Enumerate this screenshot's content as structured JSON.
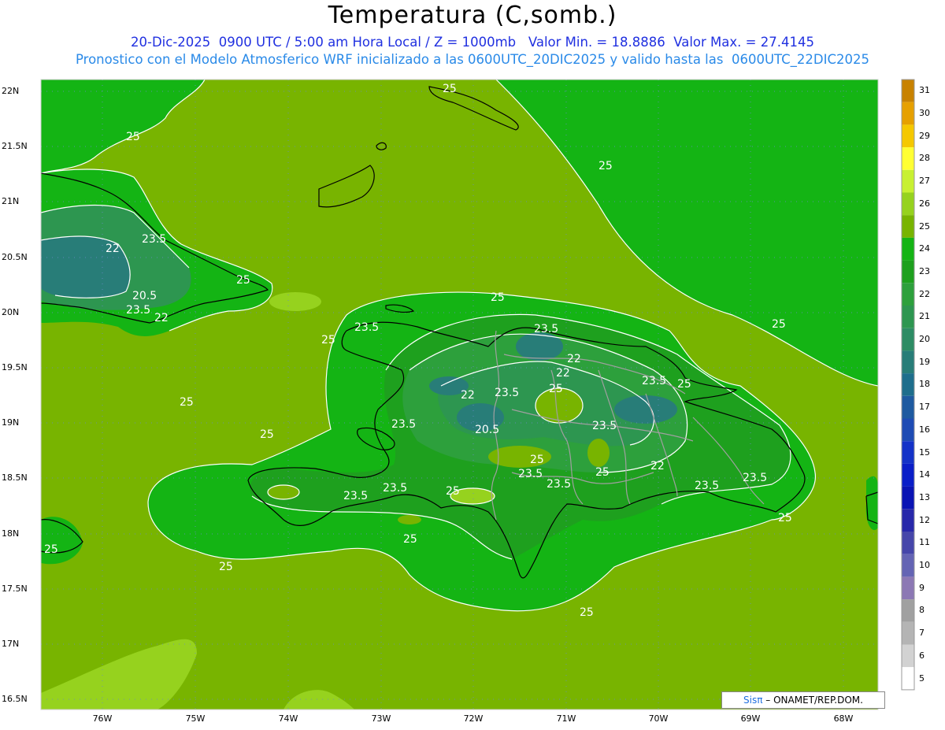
{
  "header": {
    "title": "Temperatura (C,somb.)",
    "line1": "20-Dic-2025  0900 UTC / 5:00 am Hora Local / Z = 1000mb   Valor Min. = 18.8886  Valor Max. = 27.4145",
    "line2": "Pronostico con el Modelo Atmosferico WRF inicializado a las 0600UTC_20DIC2025 y valido hasta las  0600UTC_22DIC2025"
  },
  "axes": {
    "lat_labels": [
      "22N",
      "21.5N",
      "21N",
      "20.5N",
      "20N",
      "19.5N",
      "19N",
      "18.5N",
      "18N",
      "17.5N",
      "17N",
      "16.5N"
    ],
    "lon_labels": [
      "76W",
      "75W",
      "74W",
      "73W",
      "72W",
      "71W",
      "70W",
      "69W",
      "68W"
    ]
  },
  "colorbar": {
    "levels": [
      "31",
      "30",
      "29",
      "28",
      "27",
      "26",
      "25",
      "24",
      "23",
      "22",
      "21",
      "20",
      "19",
      "18",
      "17",
      "16",
      "15",
      "14",
      "13",
      "12",
      "11",
      "10",
      "9",
      "8",
      "7",
      "6",
      "5"
    ],
    "colors": [
      "#c88200",
      "#e6a000",
      "#f5c800",
      "#ffff33",
      "#c8f032",
      "#96d21e",
      "#78b400",
      "#14b414",
      "#1ea01e",
      "#2da03c",
      "#2d9650",
      "#2d8c64",
      "#287d78",
      "#1e6e8c",
      "#1e5aa0",
      "#1e4bb4",
      "#1432c8",
      "#0a1ec8",
      "#0a14b4",
      "#2828aa",
      "#4646aa",
      "#6464b4",
      "#8c78b4",
      "#a0a0a0",
      "#b4b4b4",
      "#d2d2d2",
      "#ffffff"
    ]
  },
  "contour_labels": [
    "25",
    "23.5",
    "22",
    "20.5"
  ],
  "credit": {
    "sis": "Sisπ",
    "rest": " – ONAMET/REP.DOM."
  }
}
